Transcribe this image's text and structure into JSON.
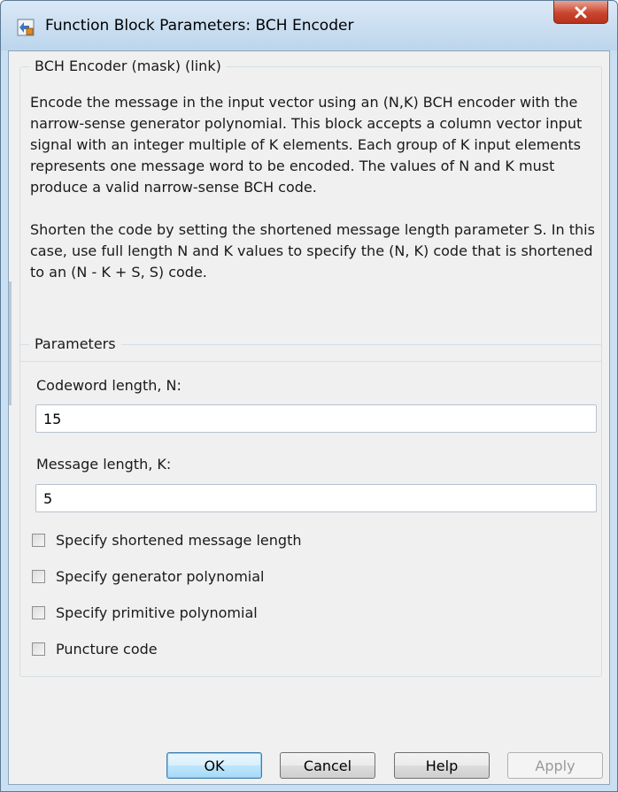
{
  "window": {
    "title": "Function Block Parameters: BCH Encoder",
    "close_glyph": "X"
  },
  "description_group": {
    "title": "BCH Encoder (mask) (link)",
    "paragraph1": "Encode the message in the input vector using an (N,K) BCH encoder with the narrow-sense generator polynomial.  This block accepts a column vector input signal with an integer multiple of K elements. Each group of K input elements represents one message word to be encoded.  The values of N and K must produce a valid narrow-sense BCH code.",
    "paragraph2": "Shorten the code by setting the shortened message length parameter S. In this case, use full length N and K values to specify the (N, K) code that is shortened to an (N - K + S, S) code."
  },
  "parameters_group": {
    "title": "Parameters",
    "codeword_label": "Codeword length, N:",
    "codeword_value": "15",
    "message_label": "Message length, K:",
    "message_value": "5",
    "checkboxes": [
      {
        "label": "Specify shortened message length",
        "checked": false
      },
      {
        "label": "Specify generator polynomial",
        "checked": false
      },
      {
        "label": "Specify primitive polynomial",
        "checked": false
      },
      {
        "label": "Puncture code",
        "checked": false
      }
    ]
  },
  "buttons": {
    "ok": "OK",
    "cancel": "Cancel",
    "help": "Help",
    "apply": "Apply"
  },
  "colors": {
    "title_bar": "#bcd5ec",
    "close_button": "#c9452e",
    "dialog_bg": "#f0f0f0",
    "default_button": "#bee6fd"
  },
  "icons": [
    "simulink-block-icon",
    "close-icon"
  ]
}
